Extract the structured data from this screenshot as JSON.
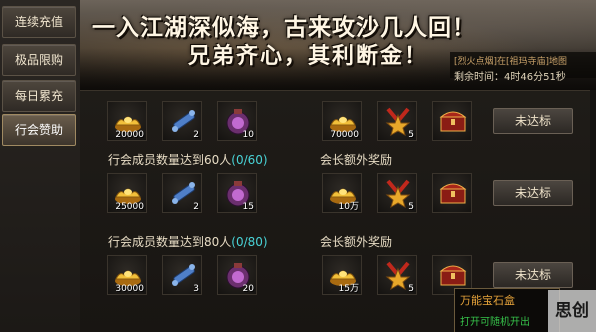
{
  "sidebar": {
    "items": [
      {
        "label": "连续充值"
      },
      {
        "label": "极品限购"
      },
      {
        "label": "每日累充"
      },
      {
        "label": "行会赞助"
      }
    ]
  },
  "banner": {
    "slogan_line1": "一入江湖深似海，古来攻沙几人回！",
    "slogan_line2": "兄弟齐心，其利断金！",
    "event_name": "[烈火点烟]在[祖玛寺庙]地图",
    "time_remaining": "剩余时间：4时46分51秒"
  },
  "rows": [
    {
      "label": "",
      "progress": "",
      "bonus_label": "",
      "rewards": [
        {
          "icon": "gold-ingot-icon",
          "qty": "20000"
        },
        {
          "icon": "scroll-icon",
          "qty": "2"
        },
        {
          "icon": "pouch-icon",
          "qty": "10"
        }
      ],
      "bonus": [
        {
          "icon": "gold-ingot-icon",
          "qty": "70000"
        },
        {
          "icon": "medal-icon",
          "qty": "5"
        },
        {
          "icon": "treasure-chest-icon",
          "qty": ""
        }
      ],
      "status": "未达标"
    },
    {
      "label": "行会成员数量达到60人",
      "progress": "(0/60)",
      "bonus_label": "会长额外奖励",
      "rewards": [
        {
          "icon": "gold-ingot-icon",
          "qty": "25000"
        },
        {
          "icon": "scroll-icon",
          "qty": "2"
        },
        {
          "icon": "pouch-icon",
          "qty": "15"
        }
      ],
      "bonus": [
        {
          "icon": "gold-ingot-icon",
          "qty": "10万"
        },
        {
          "icon": "medal-icon",
          "qty": "5"
        },
        {
          "icon": "treasure-chest-icon",
          "qty": ""
        }
      ],
      "status": "未达标"
    },
    {
      "label": "行会成员数量达到80人",
      "progress": "(0/80)",
      "bonus_label": "会长额外奖励",
      "rewards": [
        {
          "icon": "gold-ingot-icon",
          "qty": "30000"
        },
        {
          "icon": "scroll-icon",
          "qty": "3"
        },
        {
          "icon": "pouch-icon",
          "qty": "20"
        }
      ],
      "bonus": [
        {
          "icon": "gold-ingot-icon",
          "qty": "15万"
        },
        {
          "icon": "medal-icon",
          "qty": "5"
        },
        {
          "icon": "treasure-chest-icon",
          "qty": ""
        }
      ],
      "status": "未达标"
    }
  ],
  "tooltip": {
    "title": "万能宝石盒",
    "desc": "打开可随机开出"
  },
  "watermark": "思创网",
  "colors": {
    "progress": "#49d3d6",
    "tooltip_title": "#e6a33a",
    "tooltip_desc": "#36c24a"
  }
}
